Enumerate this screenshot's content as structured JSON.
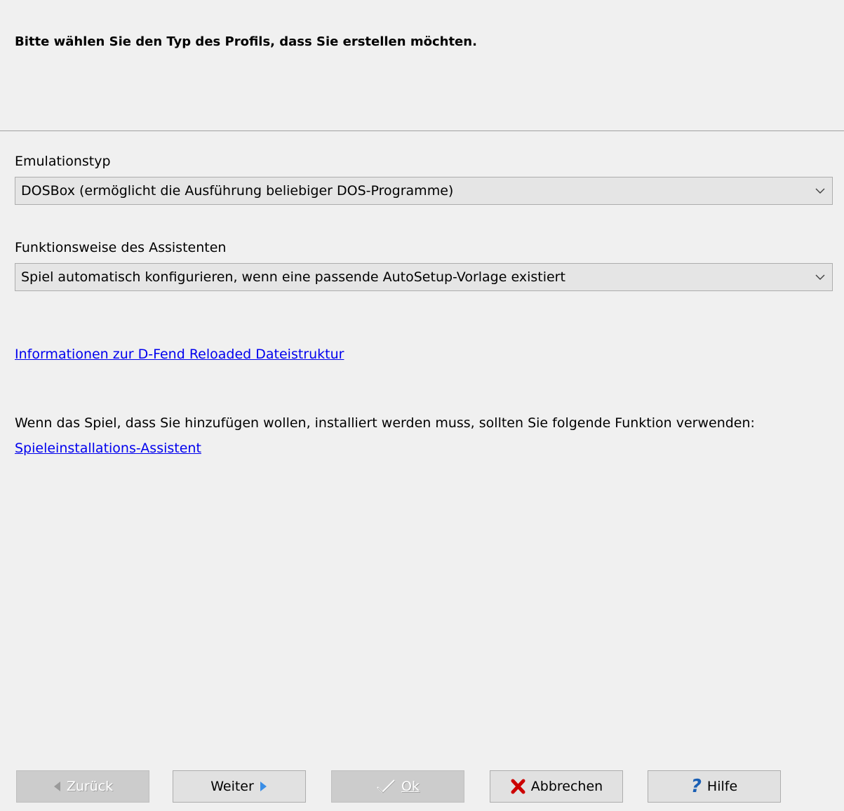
{
  "header": {
    "title": "Bitte wählen Sie den Typ des Profils, dass Sie erstellen möchten."
  },
  "emulation": {
    "label": "Emulationstyp",
    "value": "DOSBox (ermöglicht die Ausführung beliebiger DOS-Programme)"
  },
  "mode": {
    "label": "Funktionsweise des Assistenten",
    "value": "Spiel automatisch konfigurieren, wenn eine passende AutoSetup-Vorlage existiert"
  },
  "info_link": "Informationen zur D-Fend Reloaded Dateistruktur",
  "install": {
    "hint": "Wenn das Spiel, dass Sie hinzufügen wollen, installiert werden muss, sollten Sie folgende Funktion verwenden:",
    "link": "Spieleinstallations-Assistent"
  },
  "buttons": {
    "back": "Zurück",
    "next": "Weiter",
    "ok": "Ok",
    "cancel": "Abbrechen",
    "help": "Hilfe"
  },
  "icons": {
    "back": "left-triangle-icon",
    "next": "right-triangle-icon",
    "ok": "checkmark-icon",
    "cancel": "red-x-icon",
    "help": "question-mark-icon"
  },
  "colors": {
    "link": "#0000ee",
    "next_arrow": "#3a8ee6",
    "cancel_x": "#cc0000",
    "help_q": "#1a5fb4"
  }
}
